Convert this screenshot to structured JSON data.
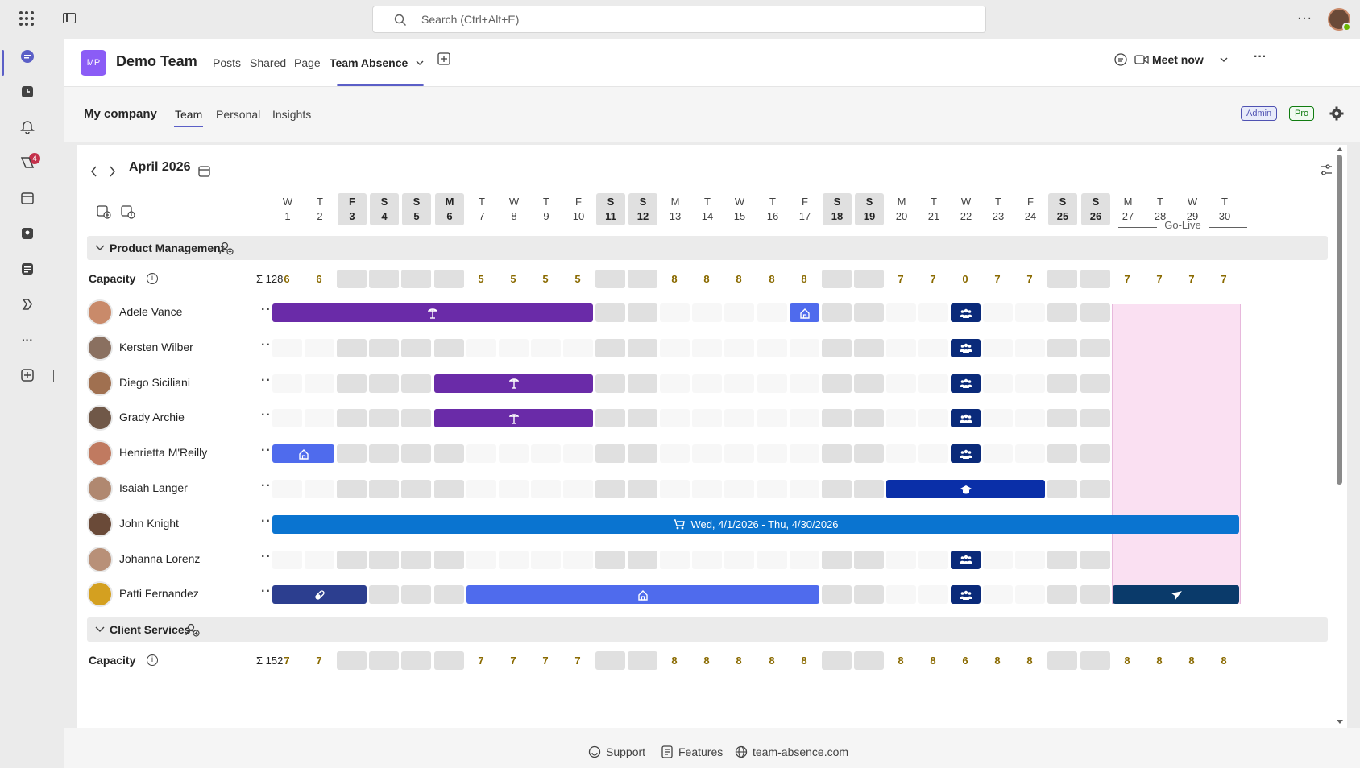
{
  "search": {
    "placeholder": "Search (Ctrl+Alt+E)"
  },
  "rail": {
    "activity_badge": "4"
  },
  "team": {
    "logo": "MP",
    "name": "Demo Team",
    "tabs": [
      "Posts",
      "Shared",
      "Page",
      "Team Absence"
    ],
    "meet_now": "Meet now"
  },
  "app": {
    "title": "My company",
    "tabs": [
      "Team",
      "Personal",
      "Insights"
    ],
    "admin_pill": "Admin",
    "pro_pill": "Pro"
  },
  "calendar": {
    "month": "April 2026",
    "go_live": "Go-Live",
    "days": [
      {
        "l": "W",
        "n": "1",
        "we": false
      },
      {
        "l": "T",
        "n": "2",
        "we": false
      },
      {
        "l": "F",
        "n": "3",
        "we": true
      },
      {
        "l": "S",
        "n": "4",
        "we": true
      },
      {
        "l": "S",
        "n": "5",
        "we": true
      },
      {
        "l": "M",
        "n": "6",
        "we": true
      },
      {
        "l": "T",
        "n": "7",
        "we": false
      },
      {
        "l": "W",
        "n": "8",
        "we": false
      },
      {
        "l": "T",
        "n": "9",
        "we": false
      },
      {
        "l": "F",
        "n": "10",
        "we": false
      },
      {
        "l": "S",
        "n": "11",
        "we": true
      },
      {
        "l": "S",
        "n": "12",
        "we": true
      },
      {
        "l": "M",
        "n": "13",
        "we": false
      },
      {
        "l": "T",
        "n": "14",
        "we": false
      },
      {
        "l": "W",
        "n": "15",
        "we": false
      },
      {
        "l": "T",
        "n": "16",
        "we": false
      },
      {
        "l": "F",
        "n": "17",
        "we": false
      },
      {
        "l": "S",
        "n": "18",
        "we": true
      },
      {
        "l": "S",
        "n": "19",
        "we": true
      },
      {
        "l": "M",
        "n": "20",
        "we": false
      },
      {
        "l": "T",
        "n": "21",
        "we": false
      },
      {
        "l": "W",
        "n": "22",
        "we": false
      },
      {
        "l": "T",
        "n": "23",
        "we": false
      },
      {
        "l": "F",
        "n": "24",
        "we": false
      },
      {
        "l": "S",
        "n": "25",
        "we": true
      },
      {
        "l": "S",
        "n": "26",
        "we": true
      },
      {
        "l": "M",
        "n": "27",
        "we": false
      },
      {
        "l": "T",
        "n": "28",
        "we": false
      },
      {
        "l": "W",
        "n": "29",
        "we": false
      },
      {
        "l": "T",
        "n": "30",
        "we": false
      }
    ]
  },
  "groups": [
    {
      "name": "Product Management",
      "capacity_label": "Capacity",
      "capacity_sum": "Σ 128",
      "capacity": [
        "6",
        "6",
        "",
        "",
        "",
        "",
        "5",
        "5",
        "5",
        "5",
        "",
        "",
        "8",
        "8",
        "8",
        "8",
        "8",
        "",
        "",
        "7",
        "7",
        "0",
        "7",
        "7",
        "",
        "",
        "7",
        "7",
        "7",
        "7"
      ],
      "members": [
        {
          "name": "Adele Vance",
          "avatar_color": "#c98a6a",
          "bars": [
            {
              "from": 1,
              "to": 10,
              "color": "#6a2ba8",
              "icon": "vacation"
            },
            {
              "from": 17,
              "to": 17,
              "color": "#4f6bed",
              "icon": "home"
            },
            {
              "from": 22,
              "to": 22,
              "color": "#0a2a7a",
              "icon": "team"
            }
          ]
        },
        {
          "name": "Kersten Wilber",
          "avatar_color": "#8a7060",
          "bars": [
            {
              "from": 22,
              "to": 22,
              "color": "#0a2a7a",
              "icon": "team"
            }
          ]
        },
        {
          "name": "Diego Siciliani",
          "avatar_color": "#a07050",
          "bars": [
            {
              "from": 6,
              "to": 10,
              "color": "#6a2ba8",
              "icon": "vacation"
            },
            {
              "from": 22,
              "to": 22,
              "color": "#0a2a7a",
              "icon": "team"
            }
          ]
        },
        {
          "name": "Grady Archie",
          "avatar_color": "#705848",
          "bars": [
            {
              "from": 6,
              "to": 10,
              "color": "#6a2ba8",
              "icon": "vacation"
            },
            {
              "from": 22,
              "to": 22,
              "color": "#0a2a7a",
              "icon": "team"
            }
          ]
        },
        {
          "name": "Henrietta M'Reilly",
          "avatar_color": "#c07a60",
          "bars": [
            {
              "from": 1,
              "to": 2,
              "color": "#4f6bed",
              "icon": "home"
            },
            {
              "from": 22,
              "to": 22,
              "color": "#0a2a7a",
              "icon": "team"
            }
          ]
        },
        {
          "name": "Isaiah Langer",
          "avatar_color": "#b08870",
          "bars": [
            {
              "from": 20,
              "to": 24,
              "color": "#0a2fa8",
              "icon": "training"
            }
          ]
        },
        {
          "name": "John Knight",
          "avatar_color": "#6a4a38",
          "bars": [
            {
              "from": 1,
              "to": 30,
              "color": "#0a74d0",
              "icon": "parental",
              "label": "Wed, 4/1/2026 - Thu, 4/30/2026"
            }
          ]
        },
        {
          "name": "Johanna Lorenz",
          "avatar_color": "#b89078",
          "bars": [
            {
              "from": 22,
              "to": 22,
              "color": "#0a2a7a",
              "icon": "team"
            }
          ]
        },
        {
          "name": "Patti Fernandez",
          "avatar_color": "#d4a020",
          "bars": [
            {
              "from": 1,
              "to": 3,
              "color": "#2c3e8f",
              "icon": "sick"
            },
            {
              "from": 7,
              "to": 17,
              "color": "#4f6bed",
              "icon": "home"
            },
            {
              "from": 22,
              "to": 22,
              "color": "#0a2a7a",
              "icon": "team"
            },
            {
              "from": 27,
              "to": 30,
              "color": "#0a3a6a",
              "icon": "travel"
            }
          ]
        }
      ]
    },
    {
      "name": "Client Services",
      "capacity_label": "Capacity",
      "capacity_sum": "Σ 152",
      "capacity": [
        "7",
        "7",
        "",
        "",
        "",
        "",
        "7",
        "7",
        "7",
        "7",
        "",
        "",
        "8",
        "8",
        "8",
        "8",
        "8",
        "",
        "",
        "8",
        "8",
        "6",
        "8",
        "8",
        "",
        "",
        "8",
        "8",
        "8",
        "8"
      ],
      "members": []
    }
  ],
  "footer": {
    "support": "Support",
    "features": "Features",
    "site": "team-absence.com"
  },
  "colors": {
    "accent": "#5b5fc7",
    "pink_go_live": "#fae0f2"
  }
}
